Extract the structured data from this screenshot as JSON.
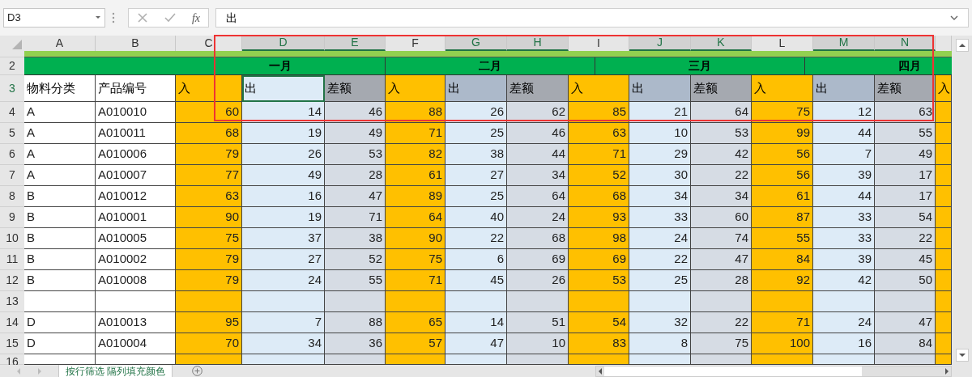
{
  "name_box": "D3",
  "formula_bar": {
    "function_label": "fx",
    "value": "出"
  },
  "columns": [
    {
      "letter": "A",
      "kind": "label",
      "selected": false
    },
    {
      "letter": "B",
      "kind": "label",
      "selected": false
    },
    {
      "letter": "C",
      "kind": "in",
      "selected": false
    },
    {
      "letter": "D",
      "kind": "out",
      "selected": true
    },
    {
      "letter": "E",
      "kind": "diff",
      "selected": true
    },
    {
      "letter": "F",
      "kind": "in",
      "selected": false
    },
    {
      "letter": "G",
      "kind": "out",
      "selected": true
    },
    {
      "letter": "H",
      "kind": "diff",
      "selected": true
    },
    {
      "letter": "I",
      "kind": "in",
      "selected": false
    },
    {
      "letter": "J",
      "kind": "out",
      "selected": true
    },
    {
      "letter": "K",
      "kind": "diff",
      "selected": true
    },
    {
      "letter": "L",
      "kind": "in",
      "selected": false
    },
    {
      "letter": "M",
      "kind": "out",
      "selected": true
    },
    {
      "letter": "N",
      "kind": "diff",
      "selected": true
    },
    {
      "kind": "in",
      "selected": false
    }
  ],
  "top_row_numbers": [
    "2",
    "3"
  ],
  "months": [
    "一月",
    "二月",
    "三月",
    "四月"
  ],
  "header_row": [
    {
      "text": "物料分类",
      "active": false
    },
    {
      "text": "产品编号",
      "active": false
    },
    {
      "text": "入",
      "active": false
    },
    {
      "text": "出",
      "active": true
    },
    {
      "text": "差额",
      "active": false
    },
    {
      "text": "入",
      "active": false
    },
    {
      "text": "出",
      "active": false
    },
    {
      "text": "差额",
      "active": false
    },
    {
      "text": "入",
      "active": false
    },
    {
      "text": "出",
      "active": false
    },
    {
      "text": "差额",
      "active": false
    },
    {
      "text": "入",
      "active": false
    },
    {
      "text": "出",
      "active": false
    },
    {
      "text": "差额",
      "active": false
    },
    {
      "text": "入",
      "active": false
    }
  ],
  "rows": [
    {
      "num": "4",
      "category": "A",
      "code": "A010010",
      "values": [
        "60",
        "14",
        "46",
        "88",
        "26",
        "62",
        "85",
        "21",
        "64",
        "75",
        "12",
        "63"
      ]
    },
    {
      "num": "5",
      "category": "A",
      "code": "A010011",
      "values": [
        "68",
        "19",
        "49",
        "71",
        "25",
        "46",
        "63",
        "10",
        "53",
        "99",
        "44",
        "55"
      ]
    },
    {
      "num": "6",
      "category": "A",
      "code": "A010006",
      "values": [
        "79",
        "26",
        "53",
        "82",
        "38",
        "44",
        "71",
        "29",
        "42",
        "56",
        "7",
        "49"
      ]
    },
    {
      "num": "7",
      "category": "A",
      "code": "A010007",
      "values": [
        "77",
        "49",
        "28",
        "61",
        "27",
        "34",
        "52",
        "30",
        "22",
        "56",
        "39",
        "17"
      ]
    },
    {
      "num": "8",
      "category": "B",
      "code": "A010012",
      "values": [
        "63",
        "16",
        "47",
        "89",
        "25",
        "64",
        "68",
        "34",
        "34",
        "61",
        "44",
        "17"
      ]
    },
    {
      "num": "9",
      "category": "B",
      "code": "A010001",
      "values": [
        "90",
        "19",
        "71",
        "64",
        "40",
        "24",
        "93",
        "33",
        "60",
        "87",
        "33",
        "54"
      ]
    },
    {
      "num": "10",
      "category": "B",
      "code": "A010005",
      "values": [
        "75",
        "37",
        "38",
        "90",
        "22",
        "68",
        "98",
        "24",
        "74",
        "55",
        "33",
        "22"
      ]
    },
    {
      "num": "11",
      "category": "B",
      "code": "A010002",
      "values": [
        "79",
        "27",
        "52",
        "75",
        "6",
        "69",
        "69",
        "22",
        "47",
        "84",
        "39",
        "45"
      ]
    },
    {
      "num": "12",
      "category": "B",
      "code": "A010008",
      "values": [
        "79",
        "24",
        "55",
        "71",
        "45",
        "26",
        "53",
        "25",
        "28",
        "92",
        "42",
        "50"
      ]
    },
    {
      "num": "13"
    },
    {
      "num": "14",
      "category": "D",
      "code": "A010013",
      "values": [
        "95",
        "7",
        "88",
        "65",
        "14",
        "51",
        "54",
        "32",
        "22",
        "71",
        "24",
        "47"
      ]
    },
    {
      "num": "15",
      "category": "D",
      "code": "A010004",
      "values": [
        "70",
        "34",
        "36",
        "57",
        "47",
        "10",
        "83",
        "8",
        "75",
        "100",
        "16",
        "84"
      ]
    },
    {
      "num": "16"
    }
  ],
  "sheet_tabs": [
    {
      "label": "按行筛选 隔列填充颜色",
      "selected": true
    }
  ]
}
